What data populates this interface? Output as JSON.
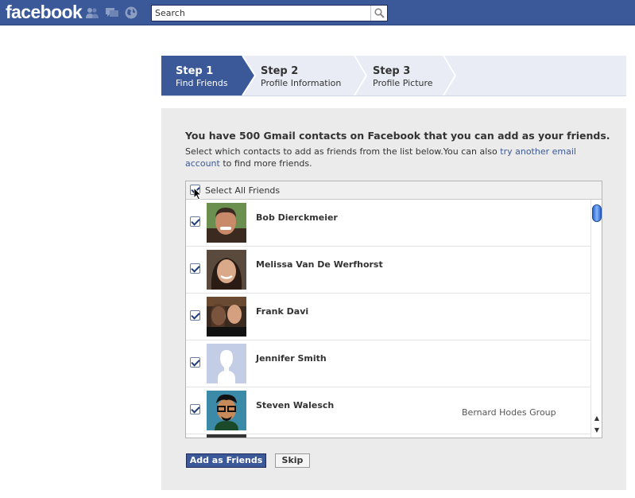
{
  "header": {
    "logo": "facebook",
    "search": {
      "placeholder": "Search",
      "value": "Search"
    },
    "icons": [
      "friend-requests-icon",
      "messages-icon",
      "notifications-icon",
      "search-icon"
    ]
  },
  "steps": [
    {
      "title": "Step 1",
      "subtitle": "Find Friends",
      "active": true
    },
    {
      "title": "Step 2",
      "subtitle": "Profile Information",
      "active": false
    },
    {
      "title": "Step 3",
      "subtitle": "Profile Picture",
      "active": false
    }
  ],
  "main": {
    "headline": "You have 500 Gmail contacts on Facebook that you can add as your friends.",
    "desc_prefix": "Select which contacts to add as friends from the list below.You can also ",
    "desc_link": "try another email account",
    "desc_suffix": " to find more friends.",
    "select_all": {
      "label": "Select All Friends",
      "checked": true
    },
    "friends": [
      {
        "name": "Bob Dierckmeier",
        "network": "",
        "checked": true,
        "avatar_icon": "profile-photo-icon"
      },
      {
        "name": "Melissa Van De Werfhorst",
        "network": "",
        "checked": true,
        "avatar_icon": "profile-photo-icon"
      },
      {
        "name": "Frank Davi",
        "network": "",
        "checked": true,
        "avatar_icon": "profile-photo-icon"
      },
      {
        "name": "Jennifer Smith",
        "network": "",
        "checked": true,
        "avatar_icon": "default-silhouette-icon"
      },
      {
        "name": "Steven Walesch",
        "network": "Bernard Hodes Group",
        "checked": true,
        "avatar_icon": "cartoon-avatar-icon"
      }
    ],
    "add_button": "Add as Friends",
    "skip_button": "Skip"
  },
  "colors": {
    "brand": "#3b5998",
    "panel": "#ebebeb",
    "link": "#3b5998"
  }
}
